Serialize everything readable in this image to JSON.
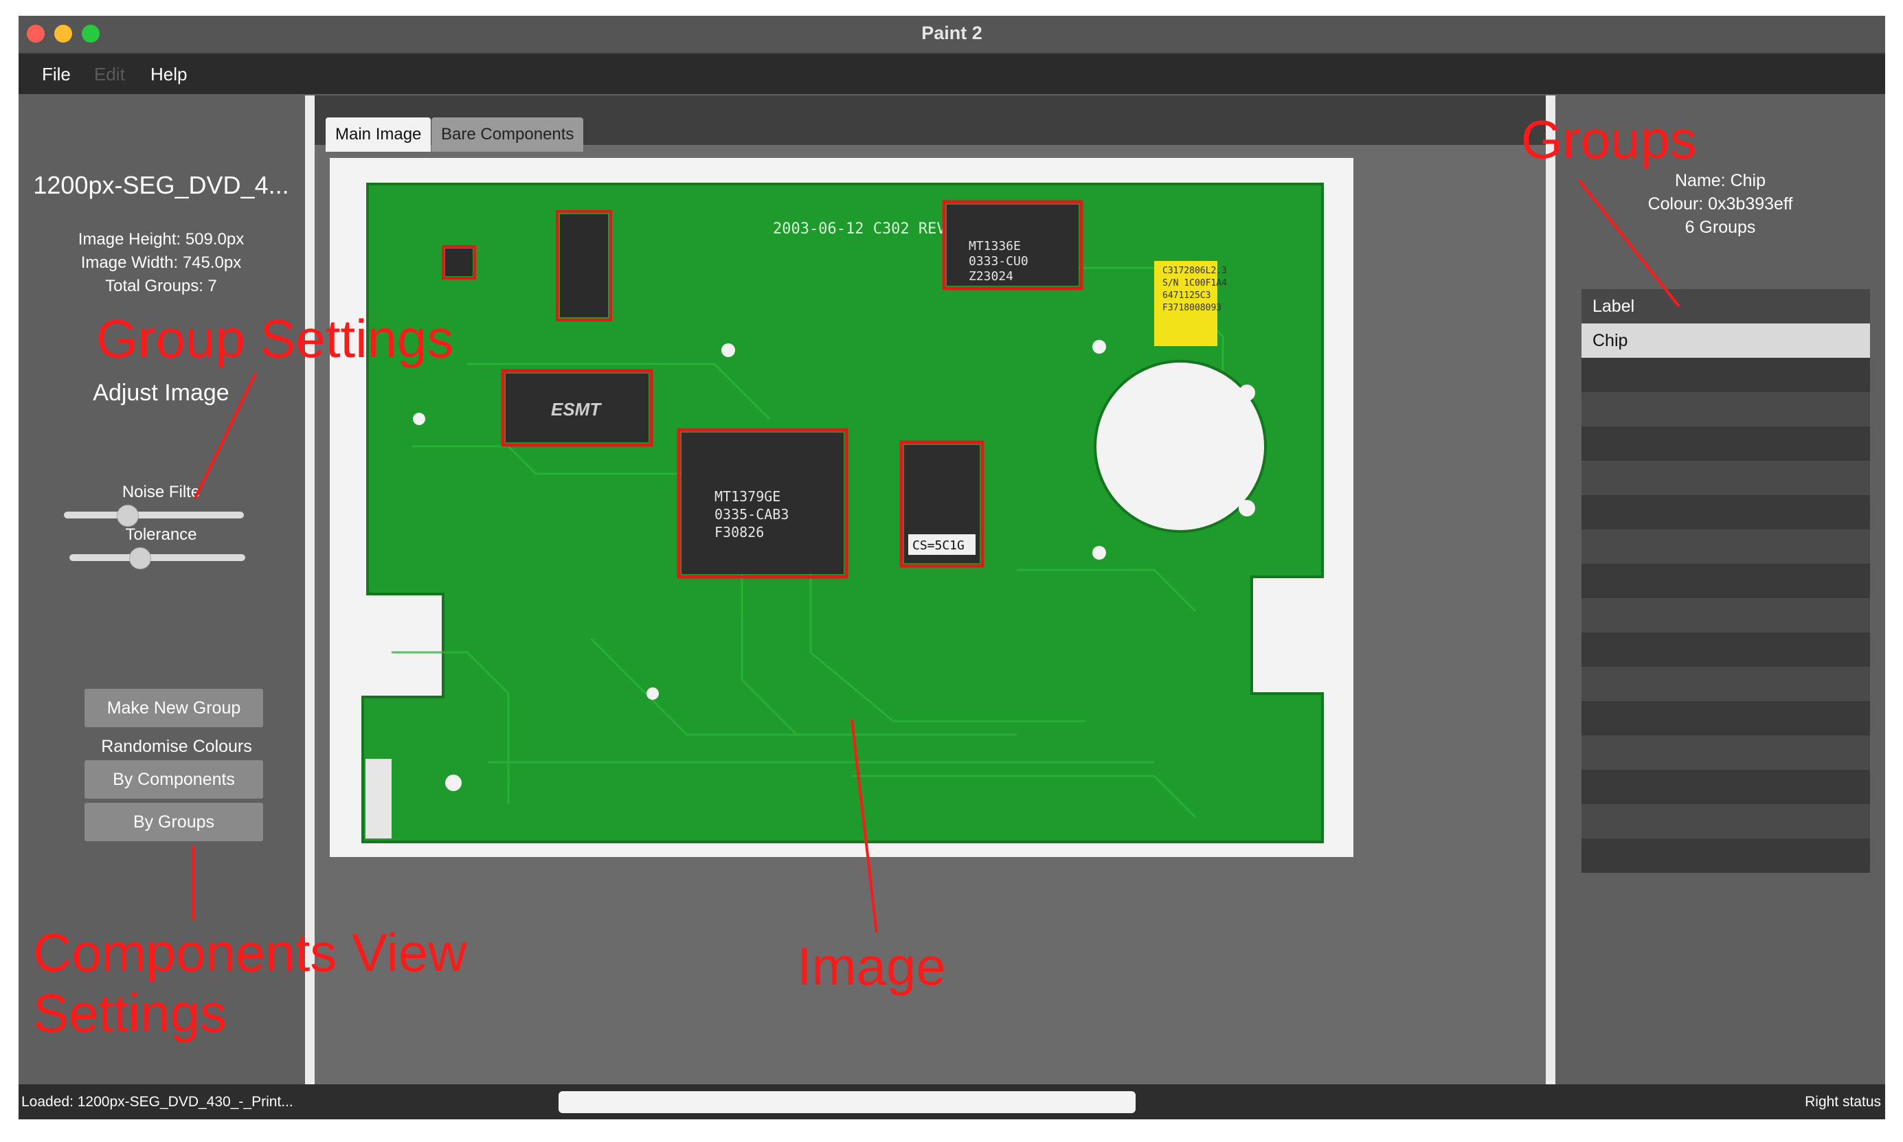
{
  "window": {
    "title": "Paint 2"
  },
  "menu": {
    "items": [
      {
        "label": "File",
        "enabled": true
      },
      {
        "label": "Edit",
        "enabled": false
      },
      {
        "label": "Help",
        "enabled": true
      }
    ]
  },
  "left_panel": {
    "filename": "1200px-SEG_DVD_4...",
    "image_height": "Image Height: 509.0px",
    "image_width": "Image Width: 745.0px",
    "total_groups": "Total Groups: 7",
    "adjust_heading": "Adjust Image",
    "noise_label": "Noise Filte",
    "noise_value": 0.35,
    "tolerance_label": "Tolerance",
    "tolerance_value": 0.4,
    "make_group_button": "Make New Group",
    "randomise_label": "Randomise Colours",
    "by_components_button": "By Components",
    "by_groups_button": "By Groups"
  },
  "tabs": [
    {
      "label": "Main Image",
      "active": true
    },
    {
      "label": "Bare Components",
      "active": false
    }
  ],
  "image": {
    "pcb_text": {
      "chip1": [
        "MT1336E",
        "0333-CU0",
        "Z23024"
      ],
      "chip2": "ESMT",
      "chip3": [
        "MT1379GE",
        "0335-CAB3",
        "F30826"
      ],
      "chip4_sticker": "CS=5C1G",
      "board_marks": "2003-06-12  C302 REV2.0",
      "yellow_label": [
        "C3172806L2.3",
        "S/N 1C00F1A4",
        "6471125C3",
        "F3718008093"
      ]
    }
  },
  "right_panel": {
    "name": "Name: Chip",
    "colour": "Colour: 0x3b393eff",
    "groups_count": "6 Groups",
    "table_header": "Label",
    "rows": [
      "Chip"
    ]
  },
  "status": {
    "left": "Loaded: 1200px-SEG_DVD_430_-_Print...",
    "right": "Right status",
    "progress": 0
  },
  "annotations": {
    "group_settings": "Group Settings",
    "components_view_1": "Components View",
    "components_view_2": "Settings",
    "image": "Image",
    "groups": "Groups"
  },
  "colors": {
    "accent_annotation": "#ff1a1a",
    "pcb_green": "#1f9a2c",
    "selection_red": "#e0191b",
    "chip_colour": "#3b393e"
  }
}
